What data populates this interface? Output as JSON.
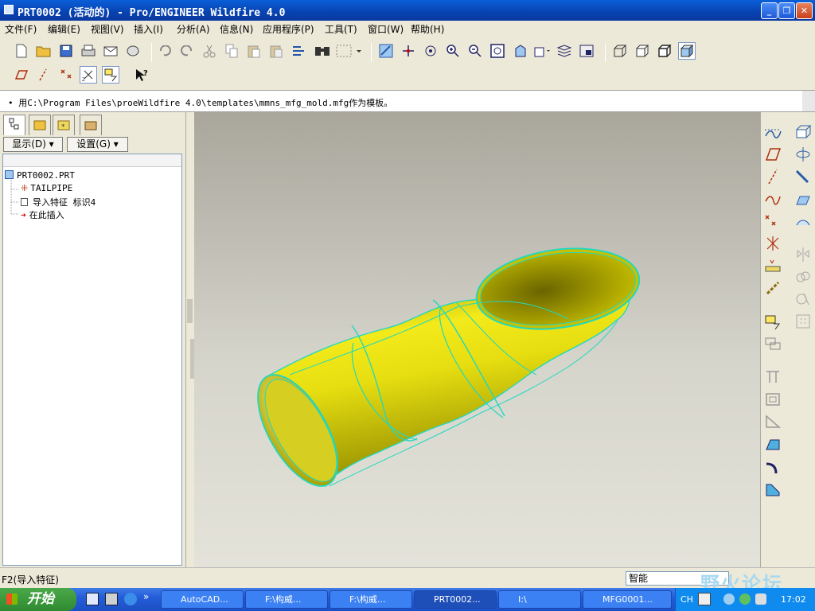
{
  "window": {
    "title": "PRT0002 (活动的) - Pro/ENGINEER Wildfire 4.0"
  },
  "menu": [
    "文件(F)",
    "编辑(E)",
    "视图(V)",
    "插入(I)",
    "分析(A)",
    "信息(N)",
    "应用程序(P)",
    "工具(T)",
    "窗口(W)",
    "帮助(H)"
  ],
  "message": "用C:\\Program Files\\proeWildfire 4.0\\templates\\mmns_mfg_mold.mfg作为模板。",
  "navigator": {
    "show_label": "显示(D) ▾",
    "settings_label": "设置(G) ▾",
    "tree": [
      {
        "label": "PRT0002.PRT",
        "icon": "part-icon"
      },
      {
        "label": "TAILPIPE",
        "icon": "csys-icon"
      },
      {
        "label": "导入特征 标识4",
        "icon": "import-feature-icon"
      },
      {
        "label": "在此插入",
        "icon": "insert-here-arrow-icon"
      }
    ]
  },
  "status": {
    "text": "F2(导入特征)",
    "filter": "智能"
  },
  "watermark": "野火论坛",
  "taskbar": {
    "start_label": "开始",
    "tasks": [
      "AutoCAD...",
      "F:\\构威...",
      "F:\\构威...",
      "PRT0002...",
      "I:\\",
      "MFG0001..."
    ],
    "clock": "17:02",
    "ime": "CH"
  },
  "colors": {
    "model": "#d8d000",
    "edges": "#18e0c8",
    "viewport_top": "#a9a69c",
    "viewport_bottom": "#e4e3da"
  }
}
